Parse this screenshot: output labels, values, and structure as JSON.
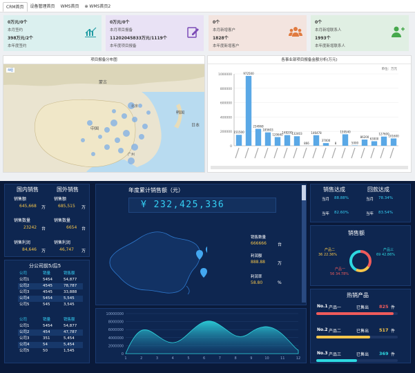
{
  "tabs": [
    "CRM首页",
    "设备管理首页",
    "WMS首页",
    "WMS首页2"
  ],
  "cards": [
    {
      "l1": "0万元/0个",
      "l2": "本月签约",
      "l3": "398万元/2个",
      "l4": "本年度签约",
      "bg": "#dbf0ef",
      "icon": "bar-chart-icon",
      "icon_color": "#1e9aa2"
    },
    {
      "l1": "0万元/0个",
      "l2": "本月项目报备",
      "l3": "11202045833万元/1119个",
      "l4": "本年度项目报备",
      "bg": "#e9e2f5",
      "icon": "edit-icon",
      "icon_color": "#7b4bb6"
    },
    {
      "l1": "0个",
      "l2": "本月新增客户",
      "l3": "1828个",
      "l4": "本年度新增客户",
      "bg": "#f3e4df",
      "icon": "group-icon",
      "icon_color": "#e07a3f"
    },
    {
      "l1": "0个",
      "l2": "本月新增联系人",
      "l3": "1993个",
      "l4": "本年度新增联系人",
      "bg": "#e0efe3",
      "icon": "add-user-icon",
      "icon_color": "#46a84c"
    }
  ],
  "map_panel": {
    "title": "项目报备分布图",
    "badge": "4组",
    "labels": [
      "蒙古",
      "中国",
      "日本",
      "韩国",
      "北京",
      "广州"
    ]
  },
  "bar_panel": {
    "title": "各事业部项目报备金额分析(万元)",
    "unit": "单位：万元"
  },
  "chart_data": {
    "type": "bar",
    "values": [
      151500,
      972500,
      234968,
      185603,
      120640,
      148200,
      132403,
      866,
      146478,
      37000,
      8,
      159540,
      5000,
      86200,
      63000,
      127600,
      101600
    ],
    "ylabel": "",
    "ylim": [
      0,
      1000000
    ],
    "yticks": [
      "0",
      "200000",
      "400000",
      "600000",
      "800000",
      "1000000"
    ],
    "color": "#5aa8e6"
  },
  "dash": {
    "domestic_title": "国内销售",
    "foreign_title": "国外销售",
    "sales_amount_label": "销售额",
    "domestic_sales": "645,668",
    "foreign_sales": "685,515",
    "unit_wan": "万",
    "sales_qty_label": "销售数量",
    "domestic_qty": "23242",
    "foreign_qty": "6654",
    "unit_tai": "台",
    "profit_label": "销售利润",
    "domestic_profit": "84,646",
    "foreign_profit": "46,747",
    "branch_title": "分公司前5/后5",
    "table_head": [
      "公司",
      "销量",
      "销售额"
    ],
    "top5": [
      [
        "公司1",
        "5454",
        "54,877"
      ],
      [
        "公司2",
        "4545",
        "78,787"
      ],
      [
        "公司3",
        "4545",
        "33,888"
      ],
      [
        "公司4",
        "5454",
        "5,545"
      ],
      [
        "公司5",
        "545",
        "3,545"
      ]
    ],
    "bottom5": [
      [
        "公司1",
        "5454",
        "54,877"
      ],
      [
        "公司2",
        "454",
        "47,787"
      ],
      [
        "公司3",
        "351",
        "5,454"
      ],
      [
        "公司4",
        "54",
        "5,454"
      ],
      [
        "公司5",
        "50",
        "1,545"
      ]
    ],
    "annual_title": "年度累计销售额（元）",
    "annual_value": "¥ 232,425,336",
    "sales_qty2_label": "销售数量",
    "sales_qty2": "666666",
    "unit_tai2": "台",
    "profit2_label": "利润额",
    "profit2": "888.88",
    "unit_wan2": "万",
    "profit_rate_label": "利润率",
    "profit_rate": "58.80",
    "pct": "%",
    "area_yticks": [
      "10000000",
      "8000000",
      "6000000",
      "4000000",
      "2000000",
      "0"
    ],
    "area_xticks": [
      "1",
      "2",
      "3",
      "4",
      "5",
      "6",
      "7",
      "8",
      "9",
      "10",
      "11",
      "12"
    ],
    "target_title": "销售达成",
    "payment_title": "回款达成",
    "month_label": "当月",
    "year_label": "当年",
    "sales_month": "88.88%",
    "sales_year": "82.60%",
    "pay_month": "78.34%",
    "pay_year": "83.54%",
    "donut_title": "销售额",
    "donut": [
      {
        "name": "产品一",
        "value": "56 34.78%",
        "pct": 34.78,
        "color": "#ef5b5b"
      },
      {
        "name": "产品二",
        "value": "36 22.36%",
        "pct": 22.36,
        "color": "#f7c64a"
      },
      {
        "name": "产品三",
        "value": "69 42.86%",
        "pct": 42.86,
        "color": "#2ed8e0"
      }
    ],
    "hot_title": "热销产品",
    "hot": [
      {
        "rank": "No.1",
        "name": "产品一",
        "sold": "已售出",
        "qty": "825",
        "unit": "件",
        "pct": 0.95,
        "color": "#ef5b5b"
      },
      {
        "rank": "No.2",
        "name": "产品二",
        "sold": "已售出",
        "qty": "517",
        "unit": "件",
        "pct": 0.66,
        "color": "#f7c64a"
      },
      {
        "rank": "No.3",
        "name": "产品三",
        "sold": "已售出",
        "qty": "369",
        "unit": "件",
        "pct": 0.5,
        "color": "#2ed8e0"
      }
    ]
  }
}
